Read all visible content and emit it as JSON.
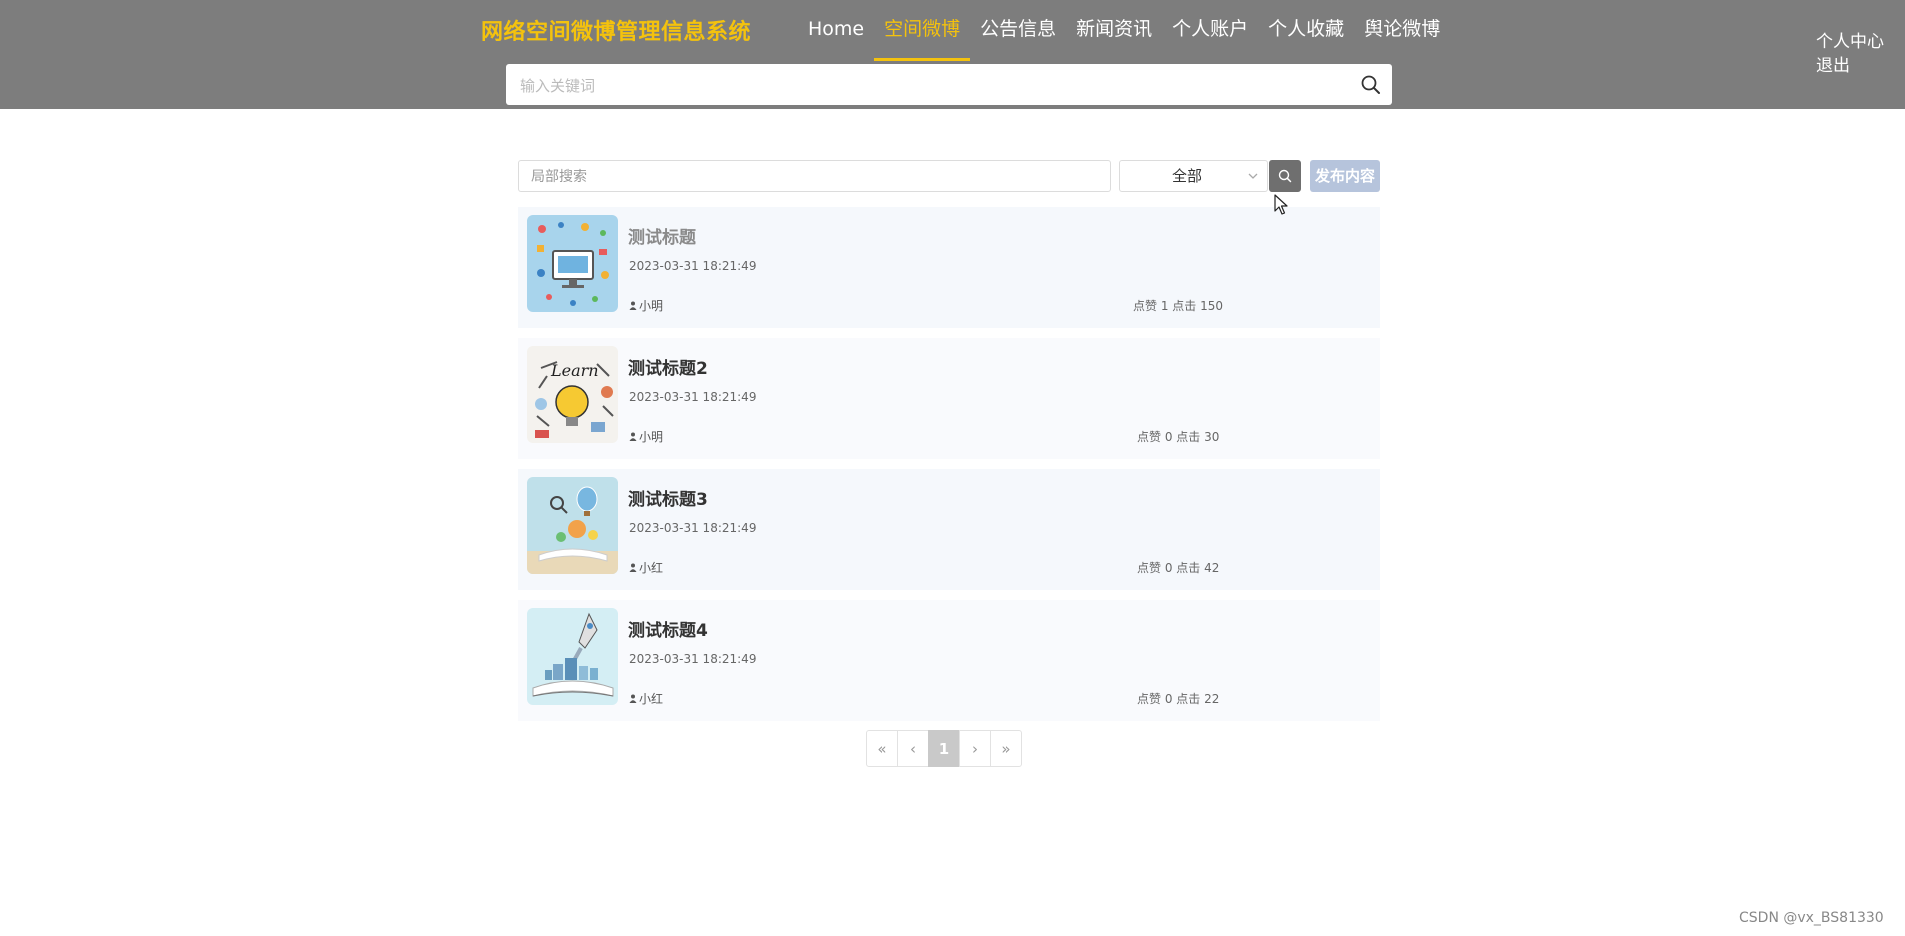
{
  "header": {
    "logo": "网络空间微博管理信息系统",
    "nav": [
      "Home",
      "空间微博",
      "公告信息",
      "新闻资讯",
      "个人账户",
      "个人收藏",
      "舆论微博"
    ],
    "active_nav": "空间微博",
    "user_center": "个人中心",
    "logout": "退出",
    "search_placeholder": "输入关键词",
    "accent": "#f4c20d",
    "background": "#7d7d7d"
  },
  "filter": {
    "local_search_placeholder": "局部搜索",
    "category": "全部",
    "publish": "发布内容"
  },
  "posts": [
    {
      "title": "测试标题",
      "date": "2023-03-31 18:21:49",
      "author": "小明",
      "stats": "点赞 1 点击 150",
      "thumb": "computer-icons-image"
    },
    {
      "title": "测试标题2",
      "date": "2023-03-31 18:21:49",
      "author": "小明",
      "stats": "点赞 0 点击 30",
      "thumb": "learn-lightbulb-image"
    },
    {
      "title": "测试标题3",
      "date": "2023-03-31 18:21:49",
      "author": "小红",
      "stats": "点赞 0 点击 42",
      "thumb": "open-book-balloon-image"
    },
    {
      "title": "测试标题4",
      "date": "2023-03-31 18:21:49",
      "author": "小红",
      "stats": "点赞 0 点击 22",
      "thumb": "book-rocket-image"
    }
  ],
  "pagination": {
    "first": "«",
    "prev": "‹",
    "current": "1",
    "next": "›",
    "last": "»"
  },
  "watermark": "CSDN @vx_BS81330"
}
